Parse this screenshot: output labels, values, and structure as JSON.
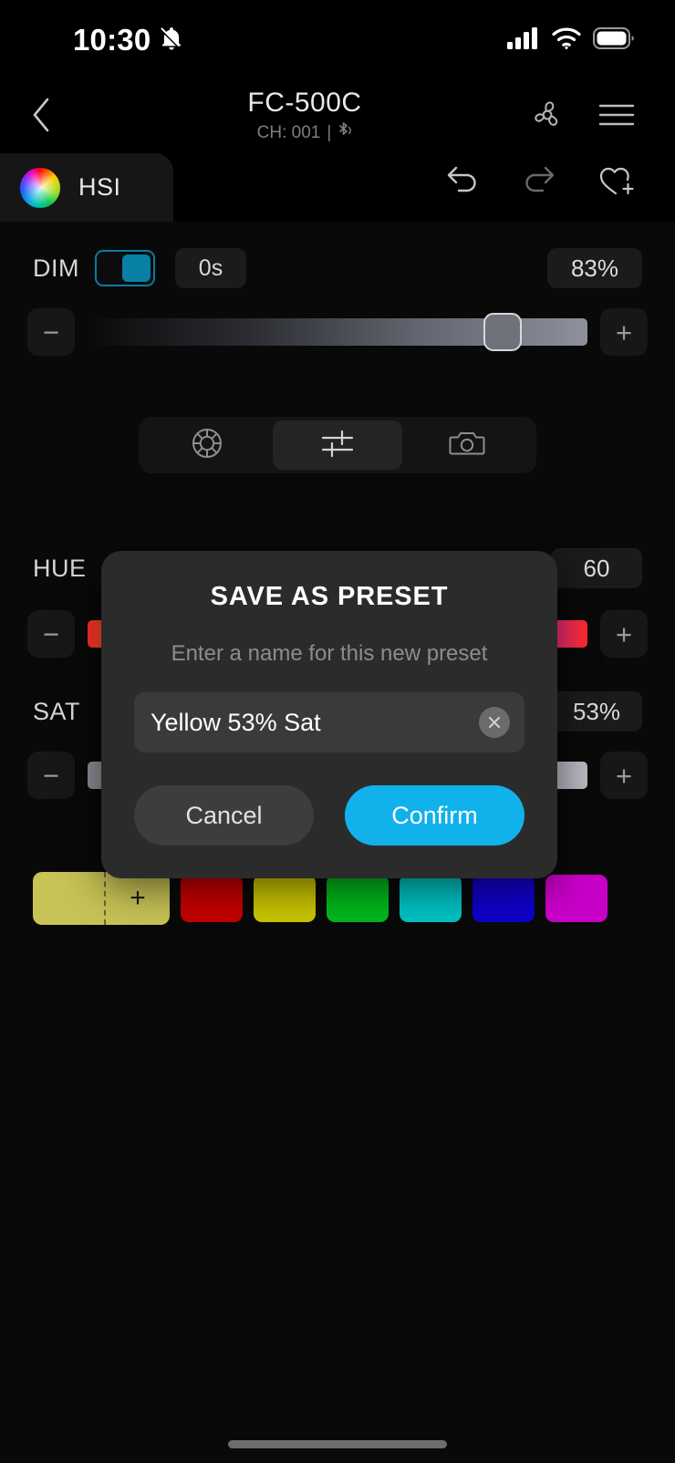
{
  "status_bar": {
    "time": "10:30",
    "icons": [
      "bell-slash-icon",
      "cellular-signal-icon",
      "wifi-icon",
      "battery-icon"
    ],
    "battery_full": true,
    "signal_bars": 4
  },
  "header": {
    "back_icon": "chevron-left-icon",
    "device_name": "FC-500C",
    "channel_label": "CH: 001",
    "separator": "|",
    "bluetooth_icon": "bluetooth-icon",
    "fan_icon": "fan-icon",
    "menu_icon": "hamburger-menu-icon"
  },
  "tabs": {
    "active": "HSI",
    "items": [
      {
        "label": "HSI",
        "icon": "color-wheel-icon"
      }
    ],
    "actions": [
      {
        "name": "undo",
        "icon": "undo-arrow-icon",
        "enabled": true
      },
      {
        "name": "redo",
        "icon": "redo-arrow-icon",
        "enabled": false
      },
      {
        "name": "add-favorite",
        "icon": "heart-plus-icon",
        "enabled": true
      }
    ]
  },
  "controls": {
    "dim": {
      "label": "DIM",
      "toggle_on": true,
      "fade_time": "0s",
      "value": "83%",
      "percent": 83,
      "minus_glyph": "−",
      "plus_glyph": "+"
    },
    "hue": {
      "label": "HUE",
      "value": "60",
      "percent": 17,
      "minus_glyph": "−",
      "plus_glyph": "+"
    },
    "sat": {
      "label": "SAT",
      "value": "53%",
      "percent": 53,
      "minus_glyph": "−",
      "plus_glyph": "+"
    }
  },
  "mode_segment": {
    "buttons": [
      {
        "name": "color-wheel-mode",
        "icon": "color-wheel-outline-icon",
        "active": false
      },
      {
        "name": "sliders-mode",
        "icon": "sliders-icon",
        "active": true
      },
      {
        "name": "camera-mode",
        "icon": "camera-icon",
        "active": false
      }
    ]
  },
  "presets": {
    "add_swatch": {
      "color": "#c7c356",
      "plus_glyph": "+",
      "name": "add-preset-swatch"
    },
    "swatches": [
      {
        "color": "#c40000"
      },
      {
        "color": "#c9c400"
      },
      {
        "color": "#00b81c"
      },
      {
        "color": "#00c2c2"
      },
      {
        "color": "#1000cc"
      },
      {
        "color": "#c800c8"
      }
    ]
  },
  "modal": {
    "title": "SAVE AS PRESET",
    "subtitle": "Enter a name for this new preset",
    "input_value": "Yellow 53% Sat",
    "input_placeholder": "Enter a name for this new preset",
    "clear_icon": "close-x-icon",
    "cancel_label": "Cancel",
    "confirm_label": "Confirm",
    "confirm_color": "#11b1ec"
  }
}
